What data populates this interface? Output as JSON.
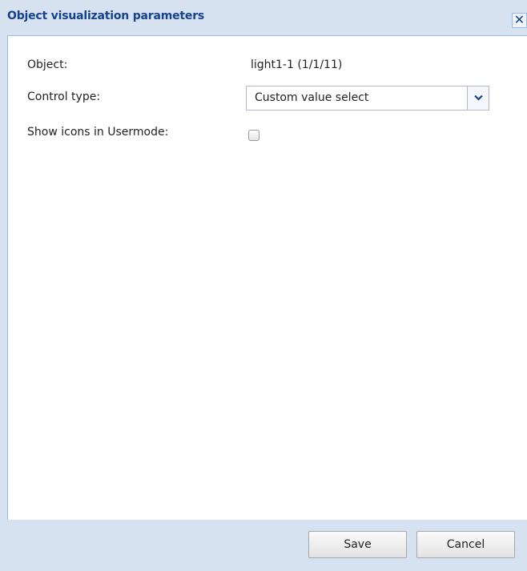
{
  "dialog": {
    "title": "Object visualization parameters",
    "close_glyph": "✕",
    "close_icon": "close-icon"
  },
  "form": {
    "object_label": "Object:",
    "object_value": "light1-1 (1/1/11)",
    "control_type_label": "Control type:",
    "control_type_value": "Custom value select",
    "dropdown_icon": "chevron-down-icon",
    "show_icons_label": "Show icons in Usermode:",
    "show_icons_checked": false
  },
  "footer": {
    "save_label": "Save",
    "cancel_label": "Cancel"
  },
  "colors": {
    "title_text": "#15428b",
    "chrome_bg": "#d7e2f1",
    "border": "#99bbe8"
  }
}
